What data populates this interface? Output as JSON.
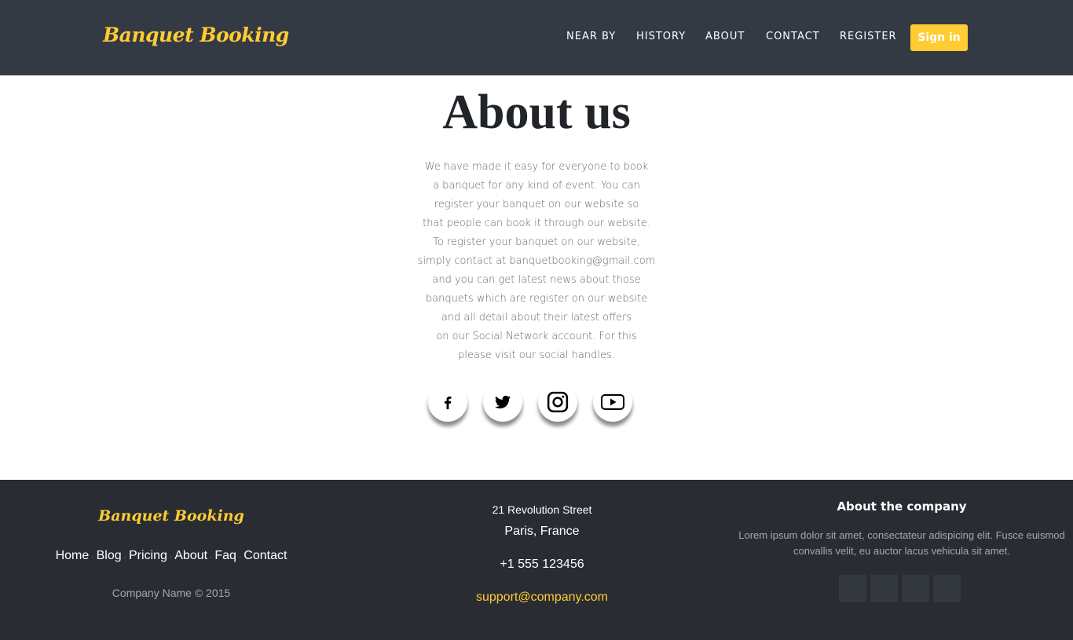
{
  "header": {
    "brand": "Banquet Booking",
    "nav": [
      "NEAR BY",
      "HISTORY",
      "ABOUT",
      "CONTACT",
      "REGISTER"
    ],
    "signin": "Sign in"
  },
  "main": {
    "title": "About us",
    "lines": [
      "We have made it easy for everyone to book",
      "a banquet for any kind of event. You can",
      "register your banquet on our website so",
      "that people can book it through our website.",
      "To register your banquet on our website,",
      "simply contact at banquetbooking@gmail.com",
      "and you can get latest news about those",
      "banquets which are register on our website",
      "and all detail about their latest offers",
      "on our Social Network account. For this",
      "please visit our social handles."
    ],
    "socials": [
      "facebook-icon",
      "twitter-icon",
      "instagram-icon",
      "youtube-icon"
    ]
  },
  "footer": {
    "brand": "Banquet Booking",
    "links": [
      "Home",
      "Blog",
      "Pricing",
      "About",
      "Faq",
      "Contact"
    ],
    "copyright": "Company Name © 2015",
    "street": "21 Revolution Street",
    "city": "Paris, France",
    "phone": "+1 555 123456",
    "email": "support@company.com",
    "about_heading": "About the company",
    "about_text_1": "Lorem ipsum dolor sit amet, consectateur adispicing elit. Fusce euismod",
    "about_text_2": "convallis velit, eu auctor lacus vehicula sit amet."
  },
  "colors": {
    "accent": "#ffcc33",
    "header_bg": "#343a43",
    "footer_bg": "#292d33"
  }
}
